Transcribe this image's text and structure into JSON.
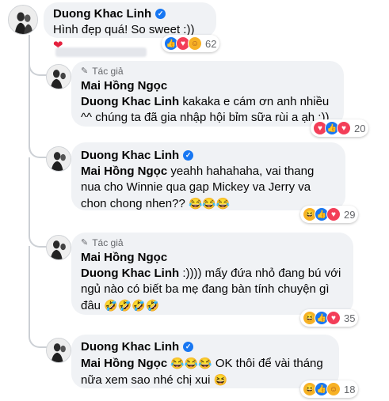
{
  "top_comment": {
    "author": "Duong Khac Linh",
    "text": "Hình đẹp quá! So sweet :))",
    "reaction_count": "62"
  },
  "replies": [
    {
      "author_badge": "Tác giả",
      "author": "Mai Hồng Ngọc",
      "mention": "Duong Khac Linh",
      "text": "kakaka e cám ơn anh nhiều ^^ chúng ta đã gia nhập hội bỉm sữa rùi a ạh :))",
      "reaction_count": "20"
    },
    {
      "author": "Duong Khac Linh",
      "mention": "Mai Hồng Ngọc",
      "text": "yeahh hahahaha, vai thang nua cho Winnie qua gap Mickey va Jerry va chon chong nhen??",
      "emoji_tail": "😂😂😂",
      "reaction_count": "29"
    },
    {
      "author_badge": "Tác giả",
      "author": "Mai Hồng Ngọc",
      "mention": "Duong Khac Linh",
      "text": ":)))) mấy đứa nhỏ đang bú với ngủ nào có biết ba mẹ đang bàn tính chuyện gì đâu",
      "emoji_tail": "🤣🤣🤣🤣",
      "reaction_count": "35"
    },
    {
      "author": "Duong Khac Linh",
      "mention": "Mai Hồng Ngọc",
      "emoji_mid": "😂😂😂",
      "text": "OK thôi để vài tháng nữa xem sao nhé chị xui",
      "emoji_tail": "😆",
      "reaction_count": "18"
    }
  ],
  "colors": {
    "bubble": "#f0f2f5",
    "verified": "#1877f2",
    "secondary_text": "#65676b"
  }
}
